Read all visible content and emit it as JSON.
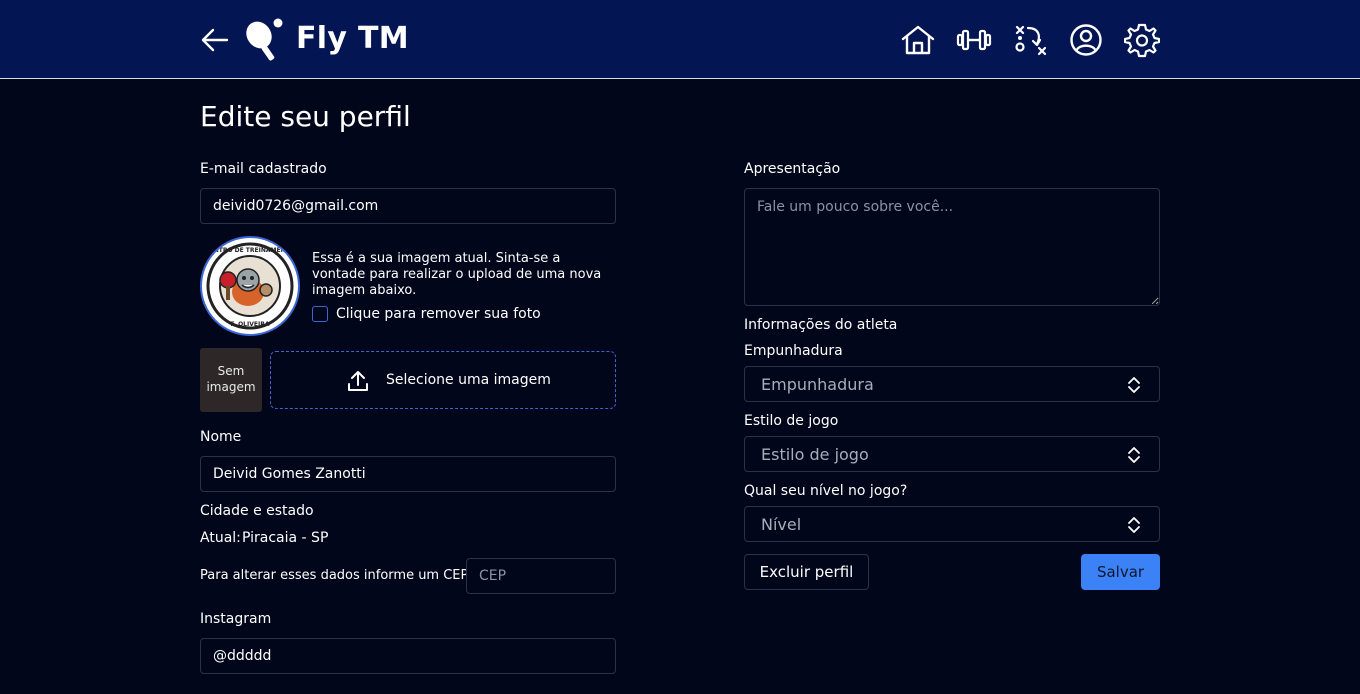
{
  "header": {
    "brand": "Fly TM",
    "icons": [
      "back-arrow-icon",
      "ping-pong-logo-icon",
      "home-icon",
      "dumbbell-icon",
      "tactics-icon",
      "user-profile-icon",
      "settings-gear-icon"
    ]
  },
  "page": {
    "title": "Edite seu perfil"
  },
  "email": {
    "label": "E-mail cadastrado",
    "value": "deivid0726@gmail.com"
  },
  "photo": {
    "description": "Essa é a sua imagem atual. Sinta-se a vontade para realizar o upload de uma nova imagem abaixo.",
    "remove_label": "Clique para remover sua foto",
    "remove_checked": false,
    "no_image_label": "Sem imagem",
    "upload_label": "Selecione uma imagem",
    "badge_top_text": "CENTRO DE TREINAMENTO",
    "badge_bottom_text": "F. OLIVEIRA"
  },
  "name": {
    "label": "Nome",
    "value": "Deivid Gomes Zanotti"
  },
  "location": {
    "label": "Cidade e estado",
    "current_prefix": "Atual:",
    "current_value": "Piracaia - SP",
    "cep_prompt": "Para alterar esses dados informe um CEP:",
    "cep_placeholder": "CEP"
  },
  "instagram": {
    "label": "Instagram",
    "value": "@ddddd"
  },
  "bio": {
    "label": "Apresentação",
    "placeholder": "Fale um pouco sobre você..."
  },
  "athlete": {
    "section_label": "Informações do atleta",
    "grip": {
      "label": "Empunhadura",
      "value": "Empunhadura"
    },
    "style": {
      "label": "Estilo de jogo",
      "value": "Estilo de jogo"
    },
    "level": {
      "label": "Qual seu nível no jogo?",
      "value": "Nível"
    }
  },
  "actions": {
    "delete_label": "Excluir perfil",
    "save_label": "Salvar"
  },
  "colors": {
    "header_bg": "#041553",
    "page_bg": "#02061a",
    "accent": "#3b82f6",
    "border": "#2d3247"
  }
}
